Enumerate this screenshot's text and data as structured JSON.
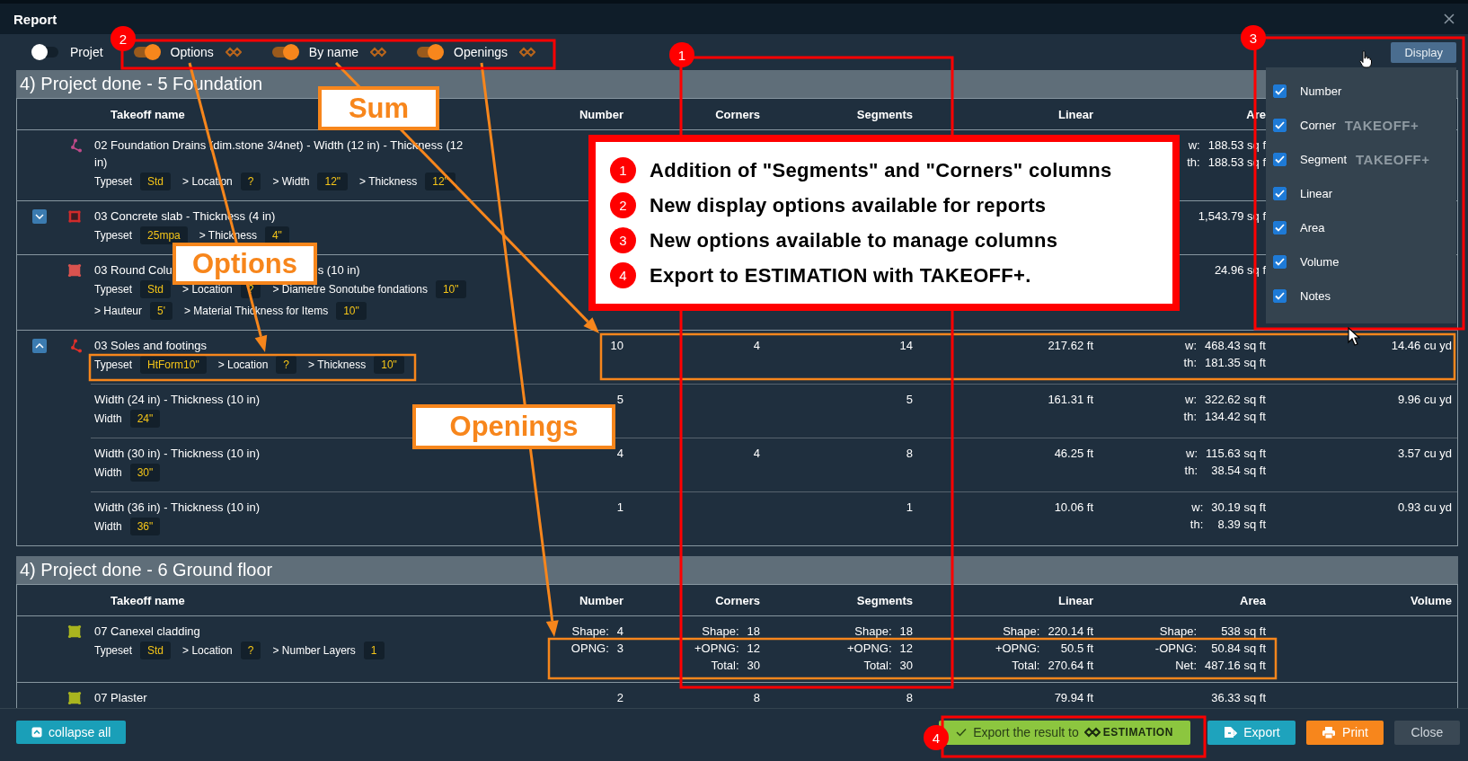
{
  "window": {
    "title": "Report"
  },
  "toolbar": {
    "toggles": [
      {
        "label": "Projet",
        "on": false,
        "kind": "plain"
      },
      {
        "label": "Options",
        "on": true,
        "kind": "takeoff"
      },
      {
        "label": "By name",
        "on": true,
        "kind": "takeoff"
      },
      {
        "label": "Openings",
        "on": true,
        "kind": "takeoff"
      }
    ],
    "display_button": "Display"
  },
  "display_menu": {
    "items": [
      {
        "label": "Number",
        "checked": true
      },
      {
        "label": "Corner",
        "checked": true,
        "badge": "TAKEOFF+"
      },
      {
        "label": "Segment",
        "checked": true,
        "badge": "TAKEOFF+"
      },
      {
        "label": "Linear",
        "checked": true
      },
      {
        "label": "Area",
        "checked": true
      },
      {
        "label": "Volume",
        "checked": true
      },
      {
        "label": "Notes",
        "checked": true
      }
    ]
  },
  "sections": [
    {
      "title": "4) Project done - 5 Foundation",
      "columns": [
        "Takeoff name",
        "Number",
        "Corners",
        "Segments",
        "Linear",
        "Are"
      ],
      "rows": [
        {
          "kind": "line",
          "color": "#c04a8a",
          "name": "02 Foundation Drains (dim.stone 3/4net) - Width (12 in) - Thickness (12 in)",
          "tags": [
            [
              {
                "label": "Typeset",
                "value": "Std"
              },
              {
                "label": "> Location",
                "value": "?"
              },
              {
                "label": "> Width",
                "value": "12\""
              },
              {
                "label": "> Thickness",
                "value": "12\""
              }
            ]
          ],
          "area": [
            {
              "label": "w:",
              "value": "188.53 sq f"
            },
            {
              "label": "th:",
              "value": "188.53 sq f"
            }
          ]
        },
        {
          "kind": "outline",
          "color": "#d02b2b",
          "expanded": false,
          "name": "03 Concrete slab - Thickness (4 in)",
          "tags": [
            [
              {
                "label": "Typeset",
                "value": "25mpa"
              },
              {
                "label": "> Thickness",
                "value": "4\""
              }
            ]
          ],
          "area": "1,543.79 sq f"
        },
        {
          "kind": "filled",
          "color": "#d9534f",
          "name": [
            "03 Round Colu",
            "s (10 in)"
          ],
          "tags": [
            [
              {
                "label": "Typeset",
                "value": "Std"
              },
              {
                "label": "> Location",
                "value": "?"
              },
              {
                "label": "> Diametre Sonotube fondations",
                "value": "10\""
              }
            ],
            [
              {
                "label": "> Hauteur",
                "value": "5'"
              },
              {
                "label": "> Material Thickness for Items",
                "value": "10\""
              }
            ]
          ],
          "area": "24.96 sq f"
        },
        {
          "kind": "line",
          "color": "#e0302a",
          "expanded": true,
          "name": "03 Soles and footings",
          "tags": [
            [
              {
                "label": "Typeset",
                "value": "HtForm10\""
              },
              {
                "label": "> Location",
                "value": "?"
              },
              {
                "label": "> Thickness",
                "value": "10\""
              }
            ]
          ],
          "number": "10",
          "corners": "4",
          "segments": "14",
          "linear": "217.62 ft",
          "area": [
            {
              "label": "w:",
              "value": "468.43 sq ft"
            },
            {
              "label": "th:",
              "value": "181.35 sq ft"
            }
          ],
          "volume": "14.46 cu yd",
          "children": [
            {
              "name": "Width (24 in) - Thickness (10 in)",
              "tags": [
                [
                  {
                    "label": "Width",
                    "value": "24\""
                  }
                ]
              ],
              "number": "5",
              "segments": "5",
              "linear": "161.31 ft",
              "area": [
                {
                  "label": "w:",
                  "value": "322.62 sq ft"
                },
                {
                  "label": "th:",
                  "value": "134.42 sq ft"
                }
              ],
              "volume": "9.96 cu yd"
            },
            {
              "name": "Width (30 in) - Thickness (10 in)",
              "tags": [
                [
                  {
                    "label": "Width",
                    "value": "30\""
                  }
                ]
              ],
              "number": "4",
              "corners": "4",
              "segments": "8",
              "linear": "46.25 ft",
              "area": [
                {
                  "label": "w:",
                  "value": "115.63 sq ft"
                },
                {
                  "label": "th:",
                  "value": "38.54 sq ft"
                }
              ],
              "volume": "3.57 cu yd"
            },
            {
              "name": "Width (36 in) - Thickness (10 in)",
              "tags": [
                [
                  {
                    "label": "Width",
                    "value": "36\""
                  }
                ]
              ],
              "number": "1",
              "segments": "1",
              "linear": "10.06 ft",
              "area": [
                {
                  "label": "w:",
                  "value": "30.19 sq ft"
                },
                {
                  "label": "th:",
                  "value": "8.39 sq ft"
                }
              ],
              "volume": "0.93 cu yd"
            }
          ]
        }
      ]
    },
    {
      "title": "4) Project done - 6 Ground floor",
      "columns": [
        "Takeoff name",
        "Number",
        "Corners",
        "Segments",
        "Linear",
        "Area",
        "Volume"
      ],
      "rows": [
        {
          "kind": "filled",
          "color": "#a9b51f",
          "name": "07 Canexel cladding",
          "tags": [
            [
              {
                "label": "Typeset",
                "value": "Std"
              },
              {
                "label": "> Location",
                "value": "?"
              },
              {
                "label": "> Number Layers",
                "value": "1"
              }
            ]
          ],
          "number": [
            {
              "label": "Shape:",
              "value": "4"
            },
            {
              "label": "OPNG:",
              "value": "3"
            }
          ],
          "corners": [
            {
              "label": "Shape:",
              "value": "18"
            },
            {
              "label": "+OPNG:",
              "value": "12"
            },
            {
              "label": "Total:",
              "value": "30"
            }
          ],
          "segments": [
            {
              "label": "Shape:",
              "value": "18"
            },
            {
              "label": "+OPNG:",
              "value": "12"
            },
            {
              "label": "Total:",
              "value": "30"
            }
          ],
          "linear": [
            {
              "label": "Shape:",
              "value": "220.14 ft"
            },
            {
              "label": "+OPNG:",
              "value": "50.5 ft"
            },
            {
              "label": "Total:",
              "value": "270.64 ft"
            }
          ],
          "area": [
            {
              "label": "Shape:",
              "value": "538 sq ft"
            },
            {
              "label": "-OPNG:",
              "value": "50.84 sq ft"
            },
            {
              "label": "Net:",
              "value": "487.16 sq ft"
            }
          ]
        },
        {
          "kind": "filled",
          "color": "#a9b51f",
          "name": "07 Plaster",
          "number": "2",
          "corners": "8",
          "segments": "8",
          "linear": "79.94 ft",
          "area": "36.33 sq ft"
        }
      ]
    }
  ],
  "footer": {
    "collapse_button": "collapse all",
    "export_estimation": {
      "text": "Export the result to",
      "brand": "ESTIMATION"
    },
    "buttons": [
      {
        "label": "Export",
        "kind": "export"
      },
      {
        "label": "Print",
        "kind": "print"
      },
      {
        "label": "Close",
        "kind": "close"
      }
    ]
  },
  "annotations": {
    "markers": [
      {
        "text": "2"
      },
      {
        "text": "1"
      },
      {
        "text": "3"
      },
      {
        "text": "4"
      }
    ],
    "labels": [
      {
        "text": "Sum"
      },
      {
        "text": "Options"
      },
      {
        "text": "Openings"
      }
    ],
    "legend": [
      {
        "number": "1",
        "text": "Addition of \"Segments\" and \"Corners\" columns"
      },
      {
        "number": "2",
        "text": "New display options available for reports"
      },
      {
        "number": "3",
        "text": "New options available to manage columns"
      },
      {
        "number": "4",
        "text": "Export to ESTIMATION with TAKEOFF+."
      }
    ]
  }
}
